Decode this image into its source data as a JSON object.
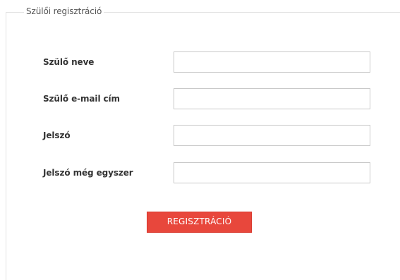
{
  "form": {
    "legend": "Szülői regisztráció",
    "fields": [
      {
        "label": "Szülő neve",
        "value": "",
        "placeholder": ""
      },
      {
        "label": "Szülő e-mail cím",
        "value": "",
        "placeholder": ""
      },
      {
        "label": "Jelszó",
        "value": "",
        "placeholder": ""
      },
      {
        "label": "Jelszó még egyszer",
        "value": "",
        "placeholder": ""
      }
    ],
    "submit_label": "REGISZTRÁCIÓ"
  },
  "colors": {
    "button_bg": "#e8473c",
    "button_text": "#ffffff",
    "border": "#e2e2e2",
    "input_border": "#c9c9c9"
  }
}
